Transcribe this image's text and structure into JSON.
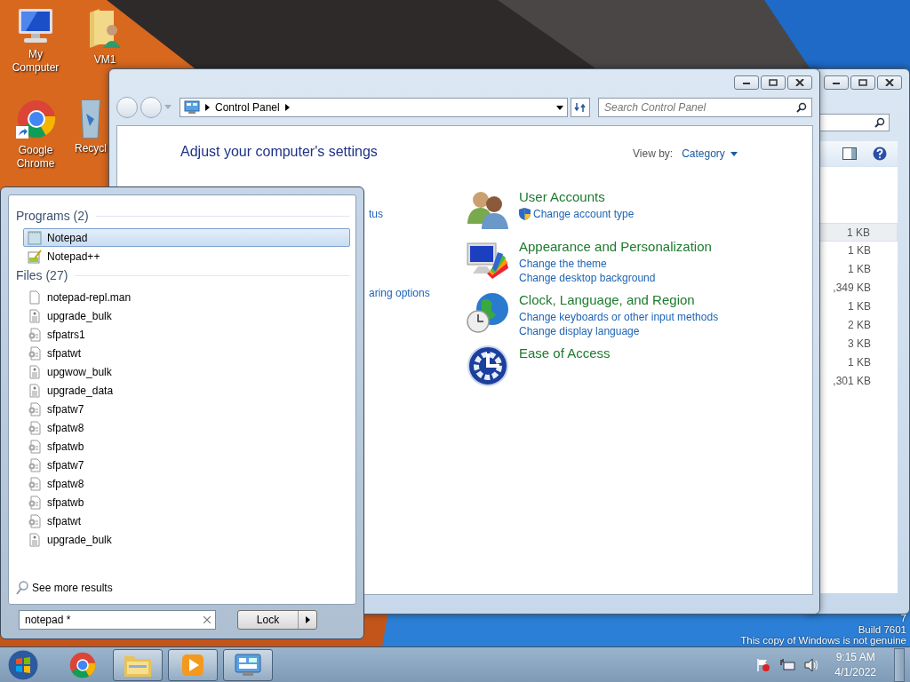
{
  "desktop_icons": [
    {
      "label": "My Computer",
      "kind": "computer"
    },
    {
      "label": "VM1",
      "kind": "user-folder"
    },
    {
      "label": "Google Chrome",
      "kind": "chrome"
    },
    {
      "label": "Recycl",
      "kind": "bin"
    }
  ],
  "background_window": {
    "sizes": [
      {
        "text": "1 KB",
        "selected": true
      },
      {
        "text": "1 KB",
        "selected": false
      },
      {
        "text": "1 KB",
        "selected": false
      },
      {
        "text": ",349 KB",
        "selected": false
      },
      {
        "text": "1 KB",
        "selected": false
      },
      {
        "text": "2 KB",
        "selected": false
      },
      {
        "text": "3 KB",
        "selected": false
      },
      {
        "text": "1 KB",
        "selected": false
      },
      {
        "text": ",301 KB",
        "selected": false
      }
    ]
  },
  "control_panel": {
    "address": "Control Panel",
    "search": {
      "placeholder": "Search Control Panel"
    },
    "heading": "Adjust your computer's settings",
    "view_by_label": "View by:",
    "view_by_value": "Category",
    "left_links": [
      "tus",
      "aring options"
    ],
    "categories": [
      {
        "title": "User Accounts",
        "kind": "users",
        "links": [
          {
            "text": "Change account type",
            "shield": true
          }
        ]
      },
      {
        "title": "Appearance and Personalization",
        "kind": "appearance",
        "links": [
          {
            "text": "Change the theme",
            "shield": false
          },
          {
            "text": "Change desktop background",
            "shield": false
          }
        ]
      },
      {
        "title": "Clock, Language, and Region",
        "kind": "clock",
        "links": [
          {
            "text": "Change keyboards or other input methods",
            "shield": false
          },
          {
            "text": "Change display language",
            "shield": false
          }
        ]
      },
      {
        "title": "Ease of Access",
        "kind": "access"
      }
    ]
  },
  "start_menu": {
    "groups": [
      {
        "title": "Programs (2)",
        "items": [
          {
            "label": "Notepad",
            "kind": "notepad",
            "selected": true
          },
          {
            "label": "Notepad++",
            "kind": "notepadpp",
            "selected": false
          }
        ]
      },
      {
        "title": "Files (27)",
        "items": [
          {
            "label": "notepad-repl.man",
            "kind": "blank",
            "selected": false
          },
          {
            "label": "upgrade_bulk",
            "kind": "script",
            "selected": false
          },
          {
            "label": "sfpatrs1",
            "kind": "gear",
            "selected": false
          },
          {
            "label": "sfpatwt",
            "kind": "gear",
            "selected": false
          },
          {
            "label": "upgwow_bulk",
            "kind": "script",
            "selected": false
          },
          {
            "label": "upgrade_data",
            "kind": "script",
            "selected": false
          },
          {
            "label": "sfpatw7",
            "kind": "gear",
            "selected": false
          },
          {
            "label": "sfpatw8",
            "kind": "gear",
            "selected": false
          },
          {
            "label": "sfpatwb",
            "kind": "gear",
            "selected": false
          },
          {
            "label": "sfpatw7",
            "kind": "gear",
            "selected": false
          },
          {
            "label": "sfpatw8",
            "kind": "gear",
            "selected": false
          },
          {
            "label": "sfpatwb",
            "kind": "gear",
            "selected": false
          },
          {
            "label": "sfpatwt",
            "kind": "gear",
            "selected": false
          },
          {
            "label": "upgrade_bulk",
            "kind": "script",
            "selected": false
          }
        ]
      }
    ],
    "see_more": "See more results",
    "search": {
      "value": "notepad *"
    },
    "lock_button": "Lock"
  },
  "desktop_notice": [
    "7",
    "Build 7601",
    "This copy of Windows is not genuine"
  ],
  "taskbar": {
    "apps": [
      {
        "kind": "chrome",
        "open": false
      },
      {
        "kind": "explorer",
        "open": true
      },
      {
        "kind": "media",
        "open": true
      },
      {
        "kind": "control",
        "open": true
      }
    ],
    "clock": {
      "time": "9:15 AM",
      "date": "4/1/2022"
    }
  }
}
